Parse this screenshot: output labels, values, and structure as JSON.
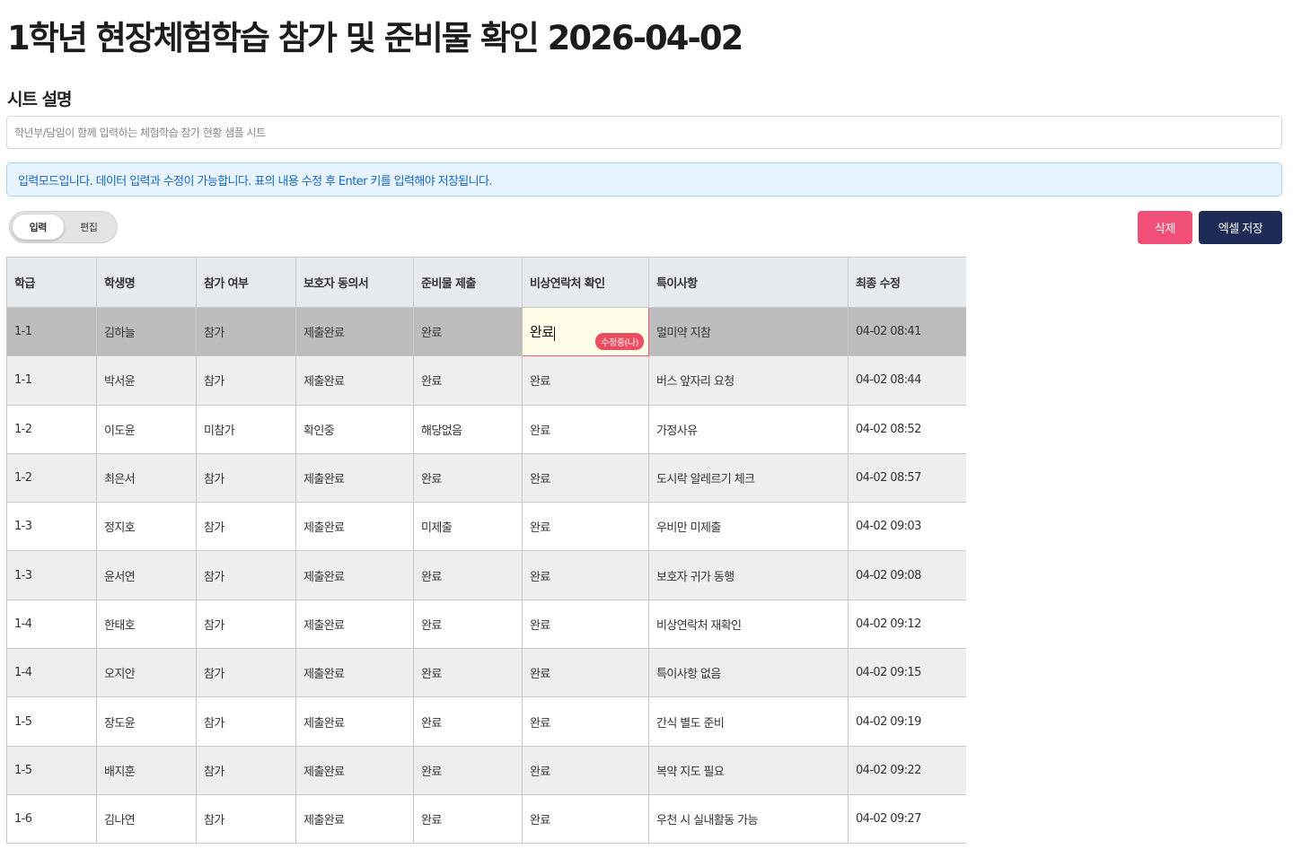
{
  "page": {
    "title": "1학년 현장체험학습 참가 및 준비물 확인 2026-04-02",
    "section_label": "시트 설명",
    "description_placeholder": "학년부/담임이 함께 입력하는 체험학습 참가 현황 샘플 시트",
    "banner": "입력모드입니다. 데이터 입력과 수정이 가능합니다. 표의 내용 수정 후 Enter 키를 입력해야 저장됩니다."
  },
  "toggle": {
    "input_label": "입력",
    "edit_label": "편집",
    "active": "input"
  },
  "toolbar": {
    "delete_label": "삭제",
    "excel_label": "엑셀 저장"
  },
  "colors": {
    "delete_button": "#f04f78",
    "excel_button": "#1f2b57",
    "banner_text": "#1668c4",
    "banner_bg": "#e8f4fd",
    "editing_border": "#ee5a6e",
    "editing_badge": "#ea4c60",
    "selected_row": "#bdbdbd"
  },
  "table": {
    "headers": [
      "학급",
      "학생명",
      "참가 여부",
      "보호자 동의서",
      "준비물 제출",
      "비상연락처 확인",
      "특이사항",
      "최종 수정"
    ],
    "editing": {
      "row": 0,
      "col": 5,
      "badge": "수정중(나)"
    },
    "rows": [
      [
        "1-1",
        "김하늘",
        "참가",
        "제출완료",
        "완료",
        "완료",
        "멀미약 지참",
        "04-02 08:41"
      ],
      [
        "1-1",
        "박서윤",
        "참가",
        "제출완료",
        "완료",
        "완료",
        "버스 앞자리 요청",
        "04-02 08:44"
      ],
      [
        "1-2",
        "이도윤",
        "미참가",
        "확인중",
        "해당없음",
        "완료",
        "가정사유",
        "04-02 08:52"
      ],
      [
        "1-2",
        "최은서",
        "참가",
        "제출완료",
        "완료",
        "완료",
        "도시락 알레르기 체크",
        "04-02 08:57"
      ],
      [
        "1-3",
        "정지호",
        "참가",
        "제출완료",
        "미제출",
        "완료",
        "우비만 미제출",
        "04-02 09:03"
      ],
      [
        "1-3",
        "윤서연",
        "참가",
        "제출완료",
        "완료",
        "완료",
        "보호자 귀가 동행",
        "04-02 09:08"
      ],
      [
        "1-4",
        "한태호",
        "참가",
        "제출완료",
        "완료",
        "완료",
        "비상연락처 재확인",
        "04-02 09:12"
      ],
      [
        "1-4",
        "오지안",
        "참가",
        "제출완료",
        "완료",
        "완료",
        "특이사항 없음",
        "04-02 09:15"
      ],
      [
        "1-5",
        "장도윤",
        "참가",
        "제출완료",
        "완료",
        "완료",
        "간식 별도 준비",
        "04-02 09:19"
      ],
      [
        "1-5",
        "배지훈",
        "참가",
        "제출완료",
        "완료",
        "완료",
        "복약 지도 필요",
        "04-02 09:22"
      ],
      [
        "1-6",
        "김나연",
        "참가",
        "제출완료",
        "완료",
        "완료",
        "우천 시 실내활동 가능",
        "04-02 09:27"
      ]
    ]
  }
}
